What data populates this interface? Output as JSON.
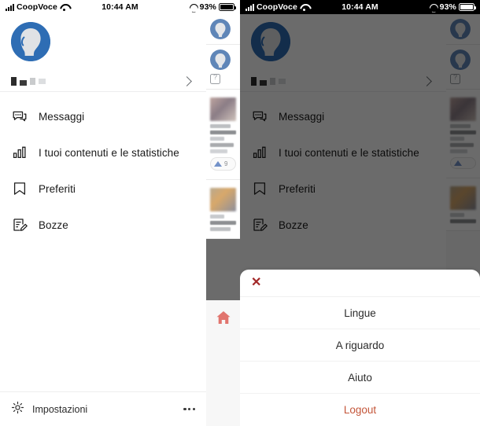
{
  "meta": {
    "app_context": "mobile-app-side-menu",
    "language": "it"
  },
  "colors": {
    "avatar_blue": "#2e6db4",
    "avatar_face": "#e0e2e5",
    "logout_orange": "#c4563a",
    "close_red": "#a22727",
    "home_icon_red": "#e1756e",
    "text_primary": "#1a1a1a",
    "divider": "#ededee",
    "overlay": "rgba(0,0,0,0.58)"
  },
  "status_bar": {
    "carrier": "CoopVoce",
    "time": "10:44 AM",
    "battery_percent": "93%",
    "signal_icon": "signal-bars-icon",
    "wifi_icon": "wifi-icon",
    "headphones_icon": "headphones-icon",
    "battery_icon": "battery-icon"
  },
  "left_panel": {
    "drawer": {
      "avatar_icon": "profile-avatar-icon",
      "username_redacted": "",
      "chevron_icon": "chevron-right-icon",
      "menu_items": [
        {
          "label": "Messaggi",
          "icon": "chat-bubble-icon"
        },
        {
          "label": "I tuoi contenuti e le statistiche",
          "icon": "bar-chart-icon"
        },
        {
          "label": "Preferiti",
          "icon": "bookmark-icon"
        },
        {
          "label": "Bozze",
          "icon": "draft-edit-icon"
        }
      ],
      "settings": {
        "label": "Impostazioni",
        "icon": "gear-icon",
        "more_icon": "ellipsis-icon"
      }
    },
    "feed_strip": {
      "help_icon": "help-badge-icon",
      "upvote_icon": "upvote-arrow-icon",
      "upvote_count": "9",
      "home_icon": "home-icon"
    }
  },
  "right_panel": {
    "drawer": {
      "avatar_icon": "profile-avatar-icon",
      "username_redacted": "",
      "chevron_icon": "chevron-right-icon",
      "menu_items": [
        {
          "label": "Messaggi",
          "icon": "chat-bubble-icon"
        },
        {
          "label": "I tuoi contenuti e le statistiche",
          "icon": "bar-chart-icon"
        },
        {
          "label": "Preferiti",
          "icon": "bookmark-icon"
        },
        {
          "label": "Bozze",
          "icon": "draft-edit-icon"
        }
      ]
    },
    "feed_strip": {
      "help_icon": "help-badge-icon",
      "upvote_icon": "upvote-arrow-icon"
    },
    "action_sheet": {
      "close_icon": "close-x-icon",
      "close_label": "✕",
      "rows": [
        {
          "label": "Lingue",
          "style": "normal"
        },
        {
          "label": "A riguardo",
          "style": "normal"
        },
        {
          "label": "Aiuto",
          "style": "normal"
        },
        {
          "label": "Logout",
          "style": "danger"
        }
      ]
    }
  }
}
